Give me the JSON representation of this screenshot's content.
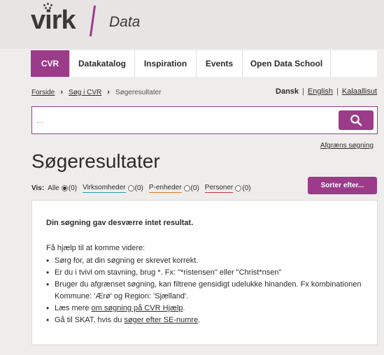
{
  "header": {
    "logo_text": "virk",
    "site_name": "Data"
  },
  "nav": {
    "items": [
      {
        "label": "CVR",
        "active": true
      },
      {
        "label": "Datakatalog"
      },
      {
        "label": "Inspiration"
      },
      {
        "label": "Events"
      },
      {
        "label": "Open Data School"
      }
    ]
  },
  "breadcrumb": {
    "home": "Forside",
    "search": "Søg i CVR",
    "current": "Søgeresultater"
  },
  "languages": {
    "current": "Dansk",
    "english": "English",
    "greenlandic": "Kalaallisut"
  },
  "search": {
    "value": "...",
    "refine_label": "Afgræns søgning"
  },
  "page_title": "Søgeresultater",
  "filters": {
    "vis_label": "Vis:",
    "options": [
      {
        "label": "Alle",
        "count": "(0)",
        "checked": true
      },
      {
        "label": "Virksomheder",
        "count": "(0)"
      },
      {
        "label": "P-enheder",
        "count": "(0)"
      },
      {
        "label": "Personer",
        "count": "(0)"
      }
    ],
    "sort_label": "Sorter efter..."
  },
  "results": {
    "no_result": "Din søgning gav desværre intet resultat.",
    "help_intro": "Få hjælp til at komme videre:",
    "tips": [
      "Sørg for, at din søgning er skrevet korrekt.",
      "Er du i tvivl om stavning, brug *. Fx: \"*ristensen\" eller \"Christ*nsen\"",
      "Bruger du afgrænset søgning, kan filtrene gensidigt udelukke hinanden. Fx kombinationen Kommune: 'Ærø' og Region: 'Sjælland'."
    ],
    "tip4_prefix": "Læs mere ",
    "tip4_link": "om søgning på CVR Hjælp",
    "tip4_suffix": ".",
    "tip5_prefix": "Gå til SKAT, hvis du ",
    "tip5_link": "søger efter SE-numre",
    "tip5_suffix": "."
  },
  "colors": {
    "accent": "#9b3b8a",
    "header_bg": "#e7e4e3",
    "page_bg": "#efedec"
  }
}
